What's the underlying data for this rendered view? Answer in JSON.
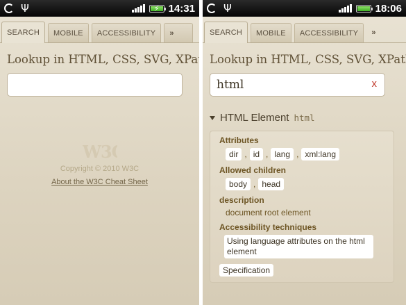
{
  "left": {
    "status": {
      "time": "14:31"
    },
    "tabs": [
      {
        "label": "SEARCH",
        "active": true
      },
      {
        "label": "MOBILE",
        "active": false
      },
      {
        "label": "ACCESSIBILITY",
        "active": false
      },
      {
        "label": "»",
        "active": false
      }
    ],
    "lookup_label": "Lookup in HTML, CSS, SVG, XPath:",
    "search": {
      "value": "",
      "placeholder": ""
    },
    "logo_text": "W3C",
    "copyright": "Copyright © 2010 W3C",
    "about_link": "About the W3C Cheat Sheet"
  },
  "right": {
    "status": {
      "time": "18:06"
    },
    "tabs": [
      {
        "label": "SEARCH",
        "active": true
      },
      {
        "label": "MOBILE",
        "active": false
      },
      {
        "label": "ACCESSIBILITY",
        "active": false
      },
      {
        "label": "»",
        "active": false
      }
    ],
    "lookup_label": "Lookup in HTML, CSS, SVG, XPath:",
    "search": {
      "value": "html",
      "clear": "x"
    },
    "result": {
      "title": "HTML Element",
      "tag": "html",
      "attributes_heading": "Attributes",
      "attributes": [
        "dir",
        "id",
        "lang",
        "xml:lang"
      ],
      "children_heading": "Allowed children",
      "children": [
        "body",
        "head"
      ],
      "description_heading": "description",
      "description": "document root element",
      "techniques_heading": "Accessibility techniques",
      "technique": "Using language attributes on the html element",
      "specification": "Specification"
    }
  },
  "separator": ",",
  "colors": {
    "accent": "#6d5524",
    "clear": "#c0392b",
    "background": "#e9e3d4"
  }
}
